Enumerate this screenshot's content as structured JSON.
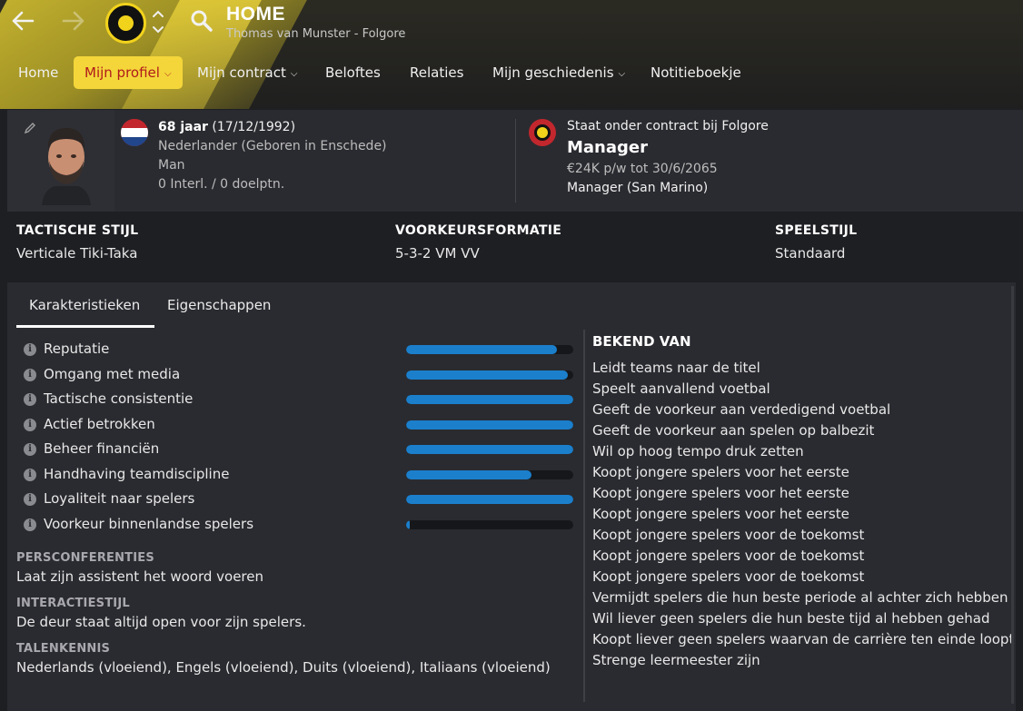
{
  "header": {
    "title": "HOME",
    "subtitle": "Thomas van Munster - Folgore"
  },
  "nav": {
    "back_icon": "arrow-left-icon",
    "forward_icon": "arrow-right-icon",
    "search_icon": "search-icon"
  },
  "tabs": [
    {
      "label": "Home",
      "dropdown": false
    },
    {
      "label": "Mijn profiel",
      "dropdown": true,
      "active": true
    },
    {
      "label": "Mijn contract",
      "dropdown": true
    },
    {
      "label": "Beloftes",
      "dropdown": false
    },
    {
      "label": "Relaties",
      "dropdown": false
    },
    {
      "label": "Mijn geschiedenis",
      "dropdown": true
    },
    {
      "label": "Notitieboekje",
      "dropdown": false
    }
  ],
  "profile": {
    "age": "68 jaar",
    "birthdate": "(17/12/1992)",
    "nationality": "Nederlander (Geboren in Enschede)",
    "gender": "Man",
    "caps": "0 Interl. / 0 doelptn."
  },
  "contract": {
    "status": "Staat onder contract bij Folgore",
    "role": "Manager",
    "wage": "€24K p/w tot 30/6/2065",
    "secondary": "Manager (San Marino)"
  },
  "tactics": [
    {
      "label": "TACTISCHE STIJL",
      "value": "Verticale Tiki-Taka"
    },
    {
      "label": "VOORKEURSFORMATIE",
      "value": "5-3-2 VM VV"
    },
    {
      "label": "SPEELSTIJL",
      "value": "Standaard"
    }
  ],
  "panel_tabs": [
    "Karakteristieken",
    "Eigenschappen"
  ],
  "attributes": [
    {
      "label": "Reputatie",
      "level": 0.9
    },
    {
      "label": "Omgang met media",
      "level": 0.97
    },
    {
      "label": "Tactische consistentie",
      "level": 1.0
    },
    {
      "label": "Actief betrokken",
      "level": 1.0
    },
    {
      "label": "Beheer financiën",
      "level": 1.0
    },
    {
      "label": "Handhaving teamdiscipline",
      "level": 0.75
    },
    {
      "label": "Loyaliteit naar spelers",
      "level": 1.0
    },
    {
      "label": "Voorkeur binnenlandse spelers",
      "level": 0.02
    }
  ],
  "sections": [
    {
      "head": "PERSCONFERENTIES",
      "value": "Laat zijn assistent het woord voeren"
    },
    {
      "head": "INTERACTIESTIJL",
      "value": "De deur staat altijd open voor zijn spelers."
    },
    {
      "head": "TALENKENNIS",
      "value": "Nederlands (vloeiend), Engels (vloeiend), Duits (vloeiend), Italiaans (vloeiend)"
    }
  ],
  "bekend_van": {
    "title": "BEKEND VAN",
    "items": [
      "Leidt teams naar de titel",
      "Speelt aanvallend voetbal",
      "Geeft de voorkeur aan verdedigend voetbal",
      "Geeft de voorkeur aan spelen op balbezit",
      "Wil op hoog tempo druk zetten",
      "Koopt jongere spelers voor het eerste",
      "Koopt jongere spelers voor het eerste",
      "Koopt jongere spelers voor het eerste",
      "Koopt jongere spelers voor de toekomst",
      "Koopt jongere spelers voor de toekomst",
      "Koopt jongere spelers voor de toekomst",
      "Vermijdt spelers die hun beste periode al achter zich hebben",
      "Wil liever geen spelers die hun beste tijd al hebben gehad",
      "Koopt liever geen spelers waarvan de carrière ten einde loopt",
      "Strenge leermeester zijn"
    ]
  },
  "colors": {
    "accent": "#f4d63a",
    "active_tab_text": "#b01b1b",
    "bar": "#1b7fcc"
  }
}
